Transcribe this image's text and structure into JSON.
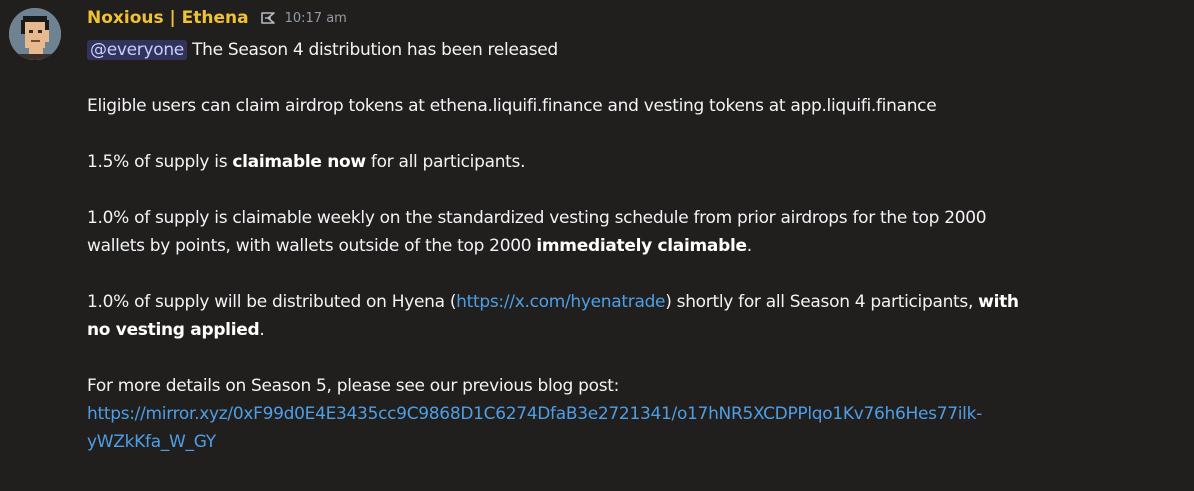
{
  "message": {
    "author": "Noxious | Ethena",
    "timestamp": "10:17 am",
    "role_icon": "ethena-role-icon",
    "avatar": "pixel-punk-avatar",
    "mention": "@everyone",
    "line1_rest": "The Season 4 distribution has been released",
    "line2": "Eligible users can claim airdrop tokens at ethena.liquifi.finance and vesting tokens at app.liquifi.finance",
    "line3_a": "1.5% of supply is ",
    "line3_b": "claimable now",
    "line3_c": " for all participants.",
    "line4_a": "1.0% of supply is claimable weekly on the standardized vesting schedule from prior airdrops for the top 2000",
    "line4_b": "wallets by points, with wallets outside of the top 2000 ",
    "line4_c": "immediately claimable",
    "line4_d": ".",
    "line5_a": "1.0% of supply will be distributed on Hyena (",
    "line5_link": "https://x.com/hyenatrade",
    "line5_b": ") shortly for all Season 4 participants, ",
    "line5_c": "with",
    "line5_d": "no vesting applied",
    "line5_e": ".",
    "line6": "For more details on Season 5, please see our previous blog post:",
    "blog_link_1": "https://mirror.xyz/0xF99d0E4E3435cc9C9868D1C6274DfaB3e2721341/o17hNR5XCDPPlqo1Kv76h6Hes77ilk-",
    "blog_link_2": "yWZkKfa_W_GY"
  },
  "colors": {
    "background": "#211f1e",
    "username": "#f0c232",
    "link": "#4e9ee6",
    "mention_bg": "#3c3f6e"
  }
}
